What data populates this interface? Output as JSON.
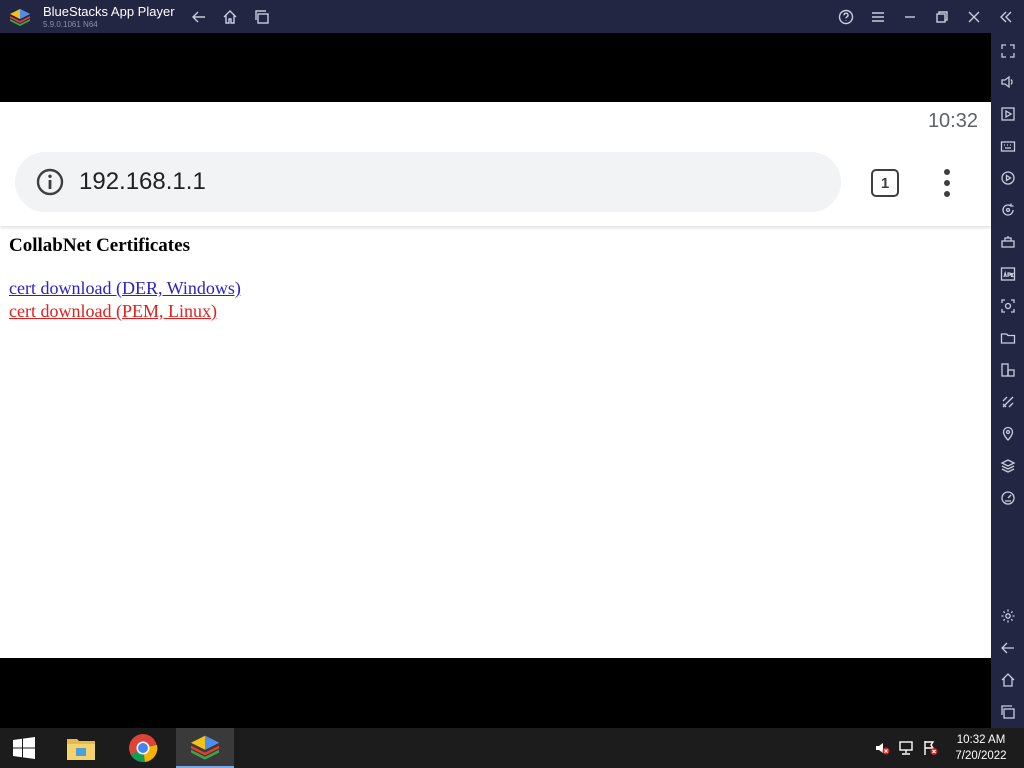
{
  "window": {
    "app_name": "BlueStacks App Player",
    "version": "5.9.0.1061 N64"
  },
  "android": {
    "status_time": "10:32"
  },
  "browser": {
    "url": "192.168.1.1",
    "tab_count": "1"
  },
  "page": {
    "heading": "CollabNet Certificates",
    "links": [
      {
        "label": "cert download (DER, Windows)"
      },
      {
        "label": "cert download (PEM, Linux)"
      }
    ]
  },
  "taskbar": {
    "time": "10:32 AM",
    "date": "7/20/2022"
  },
  "icons": {
    "titlebar": [
      "back-icon",
      "home-icon",
      "recent-apps-icon",
      "help-icon",
      "menu-icon",
      "minimize-icon",
      "restore-icon",
      "close-icon",
      "collapse-sidebar-icon"
    ],
    "sidebar": [
      "fullscreen-icon",
      "volume-icon",
      "media-icon",
      "keyboard-icon",
      "macro-icon",
      "sync-icon",
      "game-controls-icon",
      "apk-install-icon",
      "screenshot-icon",
      "folder-icon",
      "multi-instance-icon",
      "eco-mode-icon",
      "location-icon",
      "layers-icon",
      "performance-icon",
      "settings-icon",
      "android-back-icon",
      "android-home-icon",
      "android-recents-icon"
    ]
  },
  "colors": {
    "titlebar_bg": "#232642",
    "link_visited": "#2a22c8",
    "link_active": "#e0201c"
  }
}
